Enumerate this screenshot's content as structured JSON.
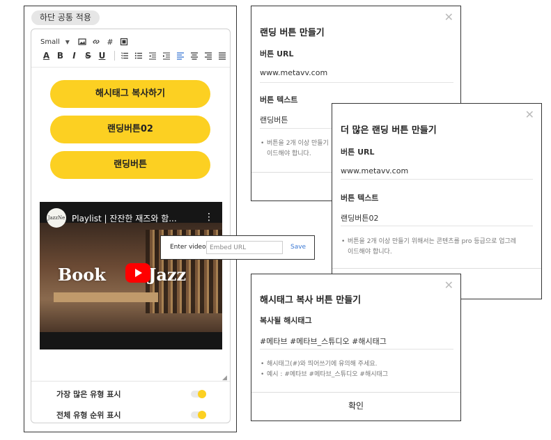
{
  "editor": {
    "section_label": "하단 공통 적용",
    "toolbar": {
      "size_label": "Small",
      "formatting": [
        "A",
        "B",
        "I",
        "S",
        "U"
      ]
    },
    "buttons": [
      {
        "label": "해시태그 복사하기"
      },
      {
        "label": "랜딩버튼02"
      },
      {
        "label": "랜딩버튼"
      }
    ],
    "video": {
      "channel_logo": "JazzNe",
      "title": "Playlist | 잔잔한 재즈와 함...",
      "overlay_left": "Book",
      "overlay_right": "Jazz"
    },
    "toggles": [
      {
        "label": "가장 많은 유형 표시",
        "on": true
      },
      {
        "label": "전체 유형 순위 표시",
        "on": true
      }
    ]
  },
  "embed_popup": {
    "label": "Enter video:",
    "placeholder": "Embed URL",
    "save_label": "Save"
  },
  "modal_landing": {
    "title": "랜딩 버튼 만들기",
    "url_label": "버튼 URL",
    "url_value": "www.metavv.com",
    "text_label": "버튼 텍스트",
    "text_value": "랜딩버튼",
    "note_line1": "버튼을 2개 이상 만들기",
    "note_line2": "이드해야 합니다."
  },
  "modal_more": {
    "title": "더 많은 랜딩 버튼 만들기",
    "url_label": "버튼 URL",
    "url_value": "www.metavv.com",
    "text_label": "버튼 텍스트",
    "text_value": "랜딩버튼02",
    "note_line1": "버튼을 2개 이상 만들기 위해서는 콘텐츠를 pro 등급으로 업그레",
    "note_line2": "이드해야 합니다."
  },
  "modal_hash": {
    "title": "해시태그 복사 버튼 만들기",
    "field_label": "복사될 해시태그",
    "field_value": "#메타브 #메타브_스튜디오 #해시태그",
    "note1": "해시태그(#)와 띄어쓰기에 유의해 주세요.",
    "note2": "예시 : #메타브 #메타브_스튜디오 #해시태그",
    "confirm_label": "확인"
  },
  "colors": {
    "accent_yellow": "#fcd022",
    "link_blue": "#3b79d4"
  }
}
